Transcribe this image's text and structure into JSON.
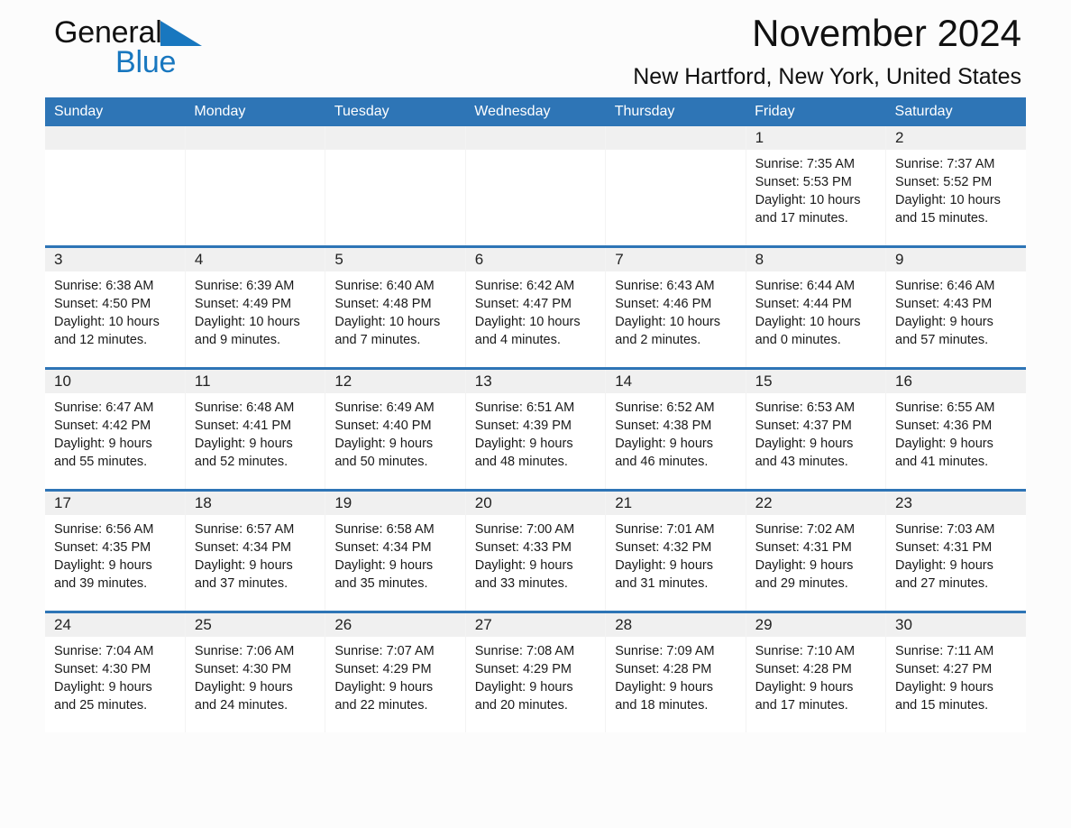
{
  "logo": {
    "word1": "General",
    "word2": "Blue",
    "triangle_color": "#1877bf",
    "word1_color": "#111111",
    "word2_color": "#1877bf"
  },
  "header": {
    "month_title": "November 2024",
    "location": "New Hartford, New York, United States",
    "header_bg_color": "#2e75b6",
    "daynum_band_color": "#f0f0f0",
    "row_separator_color": "#2e75b6"
  },
  "weekday_headers": [
    "Sunday",
    "Monday",
    "Tuesday",
    "Wednesday",
    "Thursday",
    "Friday",
    "Saturday"
  ],
  "weeks": [
    [
      {
        "day": "",
        "empty": true
      },
      {
        "day": "",
        "empty": true
      },
      {
        "day": "",
        "empty": true
      },
      {
        "day": "",
        "empty": true
      },
      {
        "day": "",
        "empty": true
      },
      {
        "day": "1",
        "sunrise": "Sunrise: 7:35 AM",
        "sunset": "Sunset: 5:53 PM",
        "daylight": "Daylight: 10 hours and 17 minutes."
      },
      {
        "day": "2",
        "sunrise": "Sunrise: 7:37 AM",
        "sunset": "Sunset: 5:52 PM",
        "daylight": "Daylight: 10 hours and 15 minutes."
      }
    ],
    [
      {
        "day": "3",
        "sunrise": "Sunrise: 6:38 AM",
        "sunset": "Sunset: 4:50 PM",
        "daylight": "Daylight: 10 hours and 12 minutes."
      },
      {
        "day": "4",
        "sunrise": "Sunrise: 6:39 AM",
        "sunset": "Sunset: 4:49 PM",
        "daylight": "Daylight: 10 hours and 9 minutes."
      },
      {
        "day": "5",
        "sunrise": "Sunrise: 6:40 AM",
        "sunset": "Sunset: 4:48 PM",
        "daylight": "Daylight: 10 hours and 7 minutes."
      },
      {
        "day": "6",
        "sunrise": "Sunrise: 6:42 AM",
        "sunset": "Sunset: 4:47 PM",
        "daylight": "Daylight: 10 hours and 4 minutes."
      },
      {
        "day": "7",
        "sunrise": "Sunrise: 6:43 AM",
        "sunset": "Sunset: 4:46 PM",
        "daylight": "Daylight: 10 hours and 2 minutes."
      },
      {
        "day": "8",
        "sunrise": "Sunrise: 6:44 AM",
        "sunset": "Sunset: 4:44 PM",
        "daylight": "Daylight: 10 hours and 0 minutes."
      },
      {
        "day": "9",
        "sunrise": "Sunrise: 6:46 AM",
        "sunset": "Sunset: 4:43 PM",
        "daylight": "Daylight: 9 hours and 57 minutes."
      }
    ],
    [
      {
        "day": "10",
        "sunrise": "Sunrise: 6:47 AM",
        "sunset": "Sunset: 4:42 PM",
        "daylight": "Daylight: 9 hours and 55 minutes."
      },
      {
        "day": "11",
        "sunrise": "Sunrise: 6:48 AM",
        "sunset": "Sunset: 4:41 PM",
        "daylight": "Daylight: 9 hours and 52 minutes."
      },
      {
        "day": "12",
        "sunrise": "Sunrise: 6:49 AM",
        "sunset": "Sunset: 4:40 PM",
        "daylight": "Daylight: 9 hours and 50 minutes."
      },
      {
        "day": "13",
        "sunrise": "Sunrise: 6:51 AM",
        "sunset": "Sunset: 4:39 PM",
        "daylight": "Daylight: 9 hours and 48 minutes."
      },
      {
        "day": "14",
        "sunrise": "Sunrise: 6:52 AM",
        "sunset": "Sunset: 4:38 PM",
        "daylight": "Daylight: 9 hours and 46 minutes."
      },
      {
        "day": "15",
        "sunrise": "Sunrise: 6:53 AM",
        "sunset": "Sunset: 4:37 PM",
        "daylight": "Daylight: 9 hours and 43 minutes."
      },
      {
        "day": "16",
        "sunrise": "Sunrise: 6:55 AM",
        "sunset": "Sunset: 4:36 PM",
        "daylight": "Daylight: 9 hours and 41 minutes."
      }
    ],
    [
      {
        "day": "17",
        "sunrise": "Sunrise: 6:56 AM",
        "sunset": "Sunset: 4:35 PM",
        "daylight": "Daylight: 9 hours and 39 minutes."
      },
      {
        "day": "18",
        "sunrise": "Sunrise: 6:57 AM",
        "sunset": "Sunset: 4:34 PM",
        "daylight": "Daylight: 9 hours and 37 minutes."
      },
      {
        "day": "19",
        "sunrise": "Sunrise: 6:58 AM",
        "sunset": "Sunset: 4:34 PM",
        "daylight": "Daylight: 9 hours and 35 minutes."
      },
      {
        "day": "20",
        "sunrise": "Sunrise: 7:00 AM",
        "sunset": "Sunset: 4:33 PM",
        "daylight": "Daylight: 9 hours and 33 minutes."
      },
      {
        "day": "21",
        "sunrise": "Sunrise: 7:01 AM",
        "sunset": "Sunset: 4:32 PM",
        "daylight": "Daylight: 9 hours and 31 minutes."
      },
      {
        "day": "22",
        "sunrise": "Sunrise: 7:02 AM",
        "sunset": "Sunset: 4:31 PM",
        "daylight": "Daylight: 9 hours and 29 minutes."
      },
      {
        "day": "23",
        "sunrise": "Sunrise: 7:03 AM",
        "sunset": "Sunset: 4:31 PM",
        "daylight": "Daylight: 9 hours and 27 minutes."
      }
    ],
    [
      {
        "day": "24",
        "sunrise": "Sunrise: 7:04 AM",
        "sunset": "Sunset: 4:30 PM",
        "daylight": "Daylight: 9 hours and 25 minutes."
      },
      {
        "day": "25",
        "sunrise": "Sunrise: 7:06 AM",
        "sunset": "Sunset: 4:30 PM",
        "daylight": "Daylight: 9 hours and 24 minutes."
      },
      {
        "day": "26",
        "sunrise": "Sunrise: 7:07 AM",
        "sunset": "Sunset: 4:29 PM",
        "daylight": "Daylight: 9 hours and 22 minutes."
      },
      {
        "day": "27",
        "sunrise": "Sunrise: 7:08 AM",
        "sunset": "Sunset: 4:29 PM",
        "daylight": "Daylight: 9 hours and 20 minutes."
      },
      {
        "day": "28",
        "sunrise": "Sunrise: 7:09 AM",
        "sunset": "Sunset: 4:28 PM",
        "daylight": "Daylight: 9 hours and 18 minutes."
      },
      {
        "day": "29",
        "sunrise": "Sunrise: 7:10 AM",
        "sunset": "Sunset: 4:28 PM",
        "daylight": "Daylight: 9 hours and 17 minutes."
      },
      {
        "day": "30",
        "sunrise": "Sunrise: 7:11 AM",
        "sunset": "Sunset: 4:27 PM",
        "daylight": "Daylight: 9 hours and 15 minutes."
      }
    ]
  ]
}
